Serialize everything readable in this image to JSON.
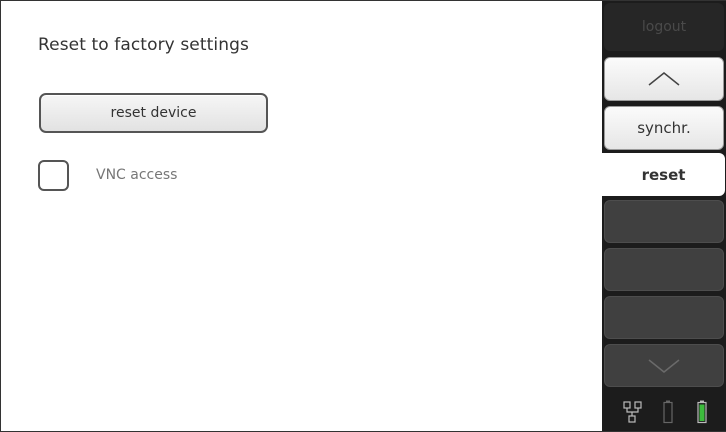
{
  "page": {
    "title": "Reset to factory settings",
    "reset_button_label": "reset device",
    "vnc_label": "VNC access",
    "vnc_checked": false
  },
  "sidebar": {
    "logout_label": "logout",
    "up_icon": "chevron-up-icon",
    "sync_label": "synchr.",
    "reset_label": "reset",
    "down_icon": "chevron-down-icon"
  },
  "status_bar": {
    "icons": [
      "network-icon",
      "battery-empty-icon",
      "battery-full-icon"
    ],
    "battery_color": "#3dbb3d"
  },
  "colors": {
    "sidebar_bg": "#1c1c1c",
    "empty_button": "#404040",
    "active_tab": "#ffffff"
  }
}
